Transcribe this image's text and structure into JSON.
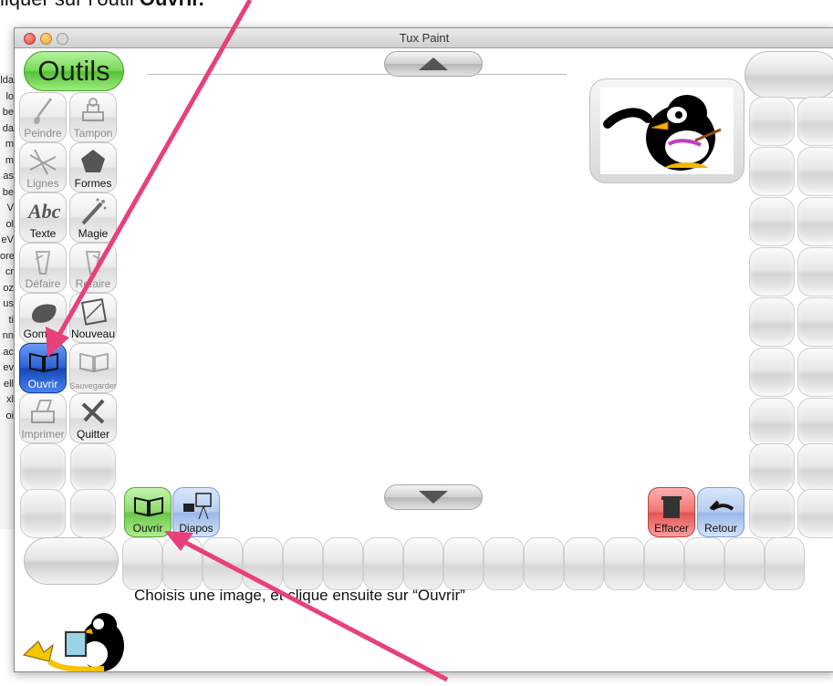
{
  "top_caption": {
    "prefix": "liquer sur l’outil ",
    "bold": "Ouvrir."
  },
  "window": {
    "title": "Tux Paint"
  },
  "behind_window_letters": [
    "lda",
    "lo",
    "be",
    "da",
    "m",
    "m",
    "as",
    "be",
    "V",
    "ol",
    "eV",
    "ore",
    "cr",
    "oz",
    "us",
    "ti",
    "nn",
    "ac",
    "ev",
    "ell",
    "xl",
    "oi"
  ],
  "toolbar": {
    "header": "Outils",
    "tools": [
      {
        "name": "paint",
        "label": "Peindre"
      },
      {
        "name": "stamp",
        "label": "Tampon"
      },
      {
        "name": "lines",
        "label": "Lignes"
      },
      {
        "name": "shapes",
        "label": "Formes"
      },
      {
        "name": "text",
        "label": "Texte"
      },
      {
        "name": "magic",
        "label": "Magie"
      },
      {
        "name": "undo",
        "label": "Défaire"
      },
      {
        "name": "redo",
        "label": "Refaire"
      },
      {
        "name": "eraser",
        "label": "Gomme"
      },
      {
        "name": "new",
        "label": "Nouveau"
      },
      {
        "name": "open",
        "label": "Ouvrir",
        "selected": true
      },
      {
        "name": "save",
        "label": "Sauvegarder"
      },
      {
        "name": "print",
        "label": "Imprimer"
      },
      {
        "name": "quit",
        "label": "Quitter"
      }
    ]
  },
  "bottom_controls": {
    "open": "Ouvrir",
    "slides": "Diapos",
    "erase": "Effacer",
    "back": "Retour"
  },
  "instruction": "Choisis une image, et clique ensuite sur “Ouvrir”",
  "colors": {
    "selected_tool": "#2b62d6",
    "open_button": "#8fdc6c",
    "erase_button": "#e25656",
    "back_button": "#b6cdf0",
    "annotation_arrow": "#e8407a"
  }
}
